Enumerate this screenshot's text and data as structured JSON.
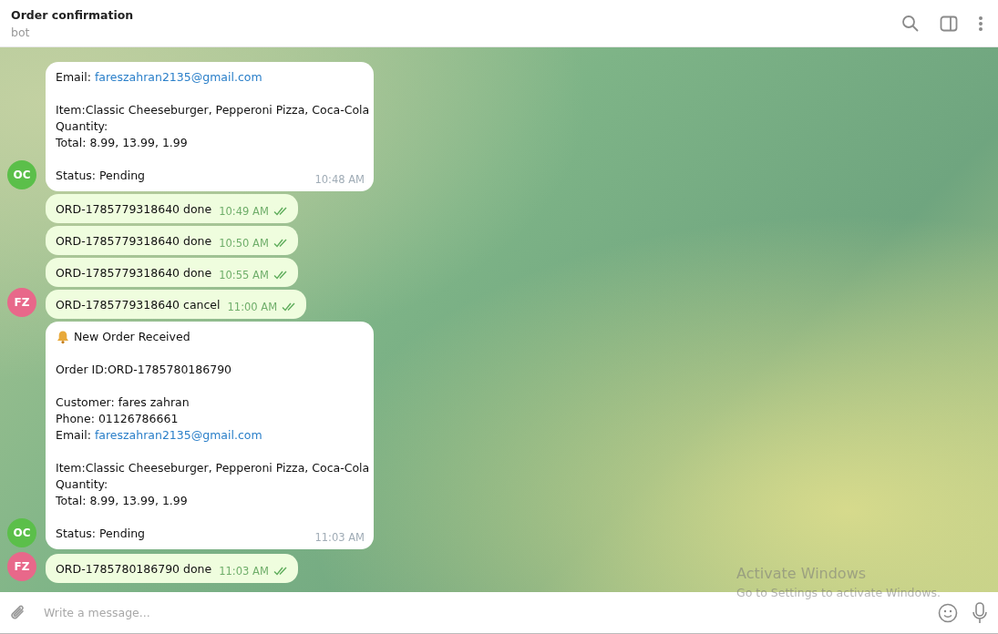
{
  "header": {
    "title": "Order confirmation",
    "subtitle": "bot"
  },
  "groups": [
    {
      "avatar": {
        "initials": "OC",
        "color": "#5bbf4a"
      },
      "messages": [
        {
          "kind": "incoming",
          "paragraphs": [
            [
              {
                "text": "Email:",
                "link": "fareszahran2135@gmail.com"
              }
            ],
            [
              {
                "text": "Item:Classic Cheeseburger, Pepperoni Pizza, Coca-Cola"
              },
              {
                "text": "Quantity:"
              },
              {
                "text": "Total: 8.99, 13.99, 1.99"
              }
            ],
            [
              {
                "text": "Status: Pending"
              }
            ]
          ],
          "time": "10:48 AM"
        }
      ]
    },
    {
      "avatar": {
        "initials": "FZ",
        "color": "#e8688a"
      },
      "messages": [
        {
          "kind": "outgoing",
          "paragraphs": [
            [
              {
                "text": "ORD-1785779318640 done"
              }
            ]
          ],
          "time": "10:49 AM",
          "read": true
        },
        {
          "kind": "outgoing",
          "paragraphs": [
            [
              {
                "text": "ORD-1785779318640 done"
              }
            ]
          ],
          "time": "10:50 AM",
          "read": true
        },
        {
          "kind": "outgoing",
          "paragraphs": [
            [
              {
                "text": "ORD-1785779318640 done"
              }
            ]
          ],
          "time": "10:55 AM",
          "read": true
        },
        {
          "kind": "outgoing",
          "paragraphs": [
            [
              {
                "text": "ORD-1785779318640 cancel"
              }
            ]
          ],
          "time": "11:00 AM",
          "read": true
        }
      ]
    },
    {
      "avatar": {
        "initials": "OC",
        "color": "#5bbf4a"
      },
      "messages": [
        {
          "kind": "incoming",
          "paragraphs": [
            [
              {
                "text": "New Order Received",
                "kind": "heading"
              }
            ],
            [
              {
                "text": "Order ID:ORD-1785780186790"
              }
            ],
            [
              {
                "text": "Customer: fares zahran"
              },
              {
                "text": "Phone: 01126786661"
              },
              {
                "text": "Email:",
                "link": "fareszahran2135@gmail.com"
              }
            ],
            [
              {
                "text": "Item:Classic Cheeseburger, Pepperoni Pizza, Coca-Cola"
              },
              {
                "text": "Quantity:"
              },
              {
                "text": "Total: 8.99, 13.99, 1.99"
              }
            ],
            [
              {
                "text": "Status: Pending"
              }
            ]
          ],
          "time": "11:03 AM"
        }
      ]
    },
    {
      "avatar": {
        "initials": "FZ",
        "color": "#e8688a"
      },
      "messages": [
        {
          "kind": "outgoing",
          "paragraphs": [
            [
              {
                "text": "ORD-1785780186790 done"
              }
            ]
          ],
          "time": "11:03 AM",
          "read": true
        }
      ]
    }
  ],
  "composer": {
    "placeholder": "Write a message..."
  },
  "activation": {
    "title": "Activate Windows",
    "subtitle": "Go to Settings to activate Windows."
  }
}
